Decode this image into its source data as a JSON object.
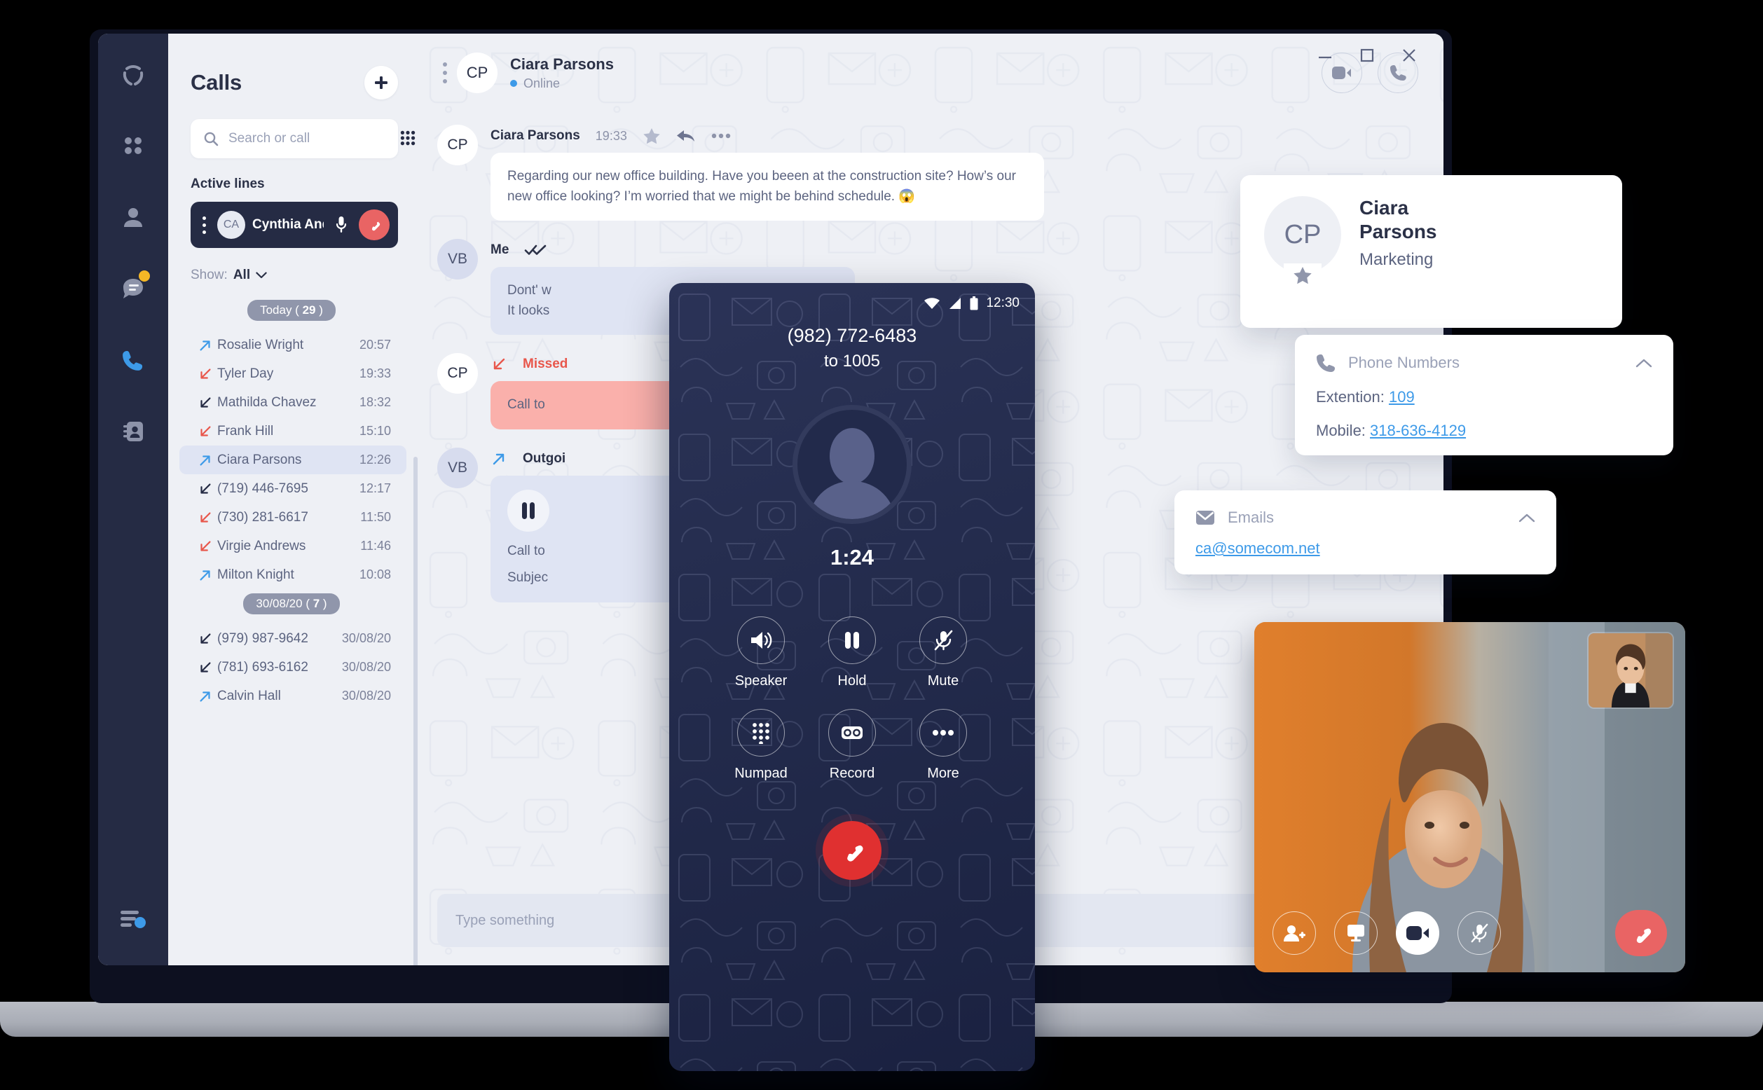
{
  "app": {
    "window_controls": {
      "minimize": "minimize-icon",
      "maximize": "maximize-icon",
      "close": "close-icon"
    }
  },
  "rail": {
    "logo": "app-logo",
    "items": [
      {
        "icon": "grid-apps-icon",
        "badge": ""
      },
      {
        "icon": "user-presence-icon",
        "badge": ""
      },
      {
        "icon": "chat-bubble-icon",
        "badge": "unread"
      },
      {
        "icon": "phone-icon",
        "badge": "",
        "active": true
      },
      {
        "icon": "contacts-book-icon",
        "badge": ""
      }
    ],
    "bottom_item": {
      "icon": "activity-list-icon"
    }
  },
  "calls_panel": {
    "title": "Calls",
    "add_button": "+",
    "search": {
      "placeholder": "Search or call",
      "value": "",
      "keypad_icon": "dialpad-icon"
    },
    "active_lines_label": "Active lines",
    "active_line": {
      "initials": "CA",
      "name": "Cynthia Ande...",
      "mic_icon": "microphone-icon",
      "end_icon": "hangup-icon"
    },
    "show_label": "Show:",
    "show_value": "All",
    "groups": [
      {
        "label": "Today",
        "count": "29",
        "rows": [
          {
            "direction": "outgoing",
            "name": "Rosalie Wright",
            "time": "20:57",
            "selected": false
          },
          {
            "direction": "missed",
            "name": "Tyler Day",
            "time": "19:33",
            "selected": false
          },
          {
            "direction": "incoming",
            "name": "Mathilda Chavez",
            "time": "18:32",
            "selected": false
          },
          {
            "direction": "missed",
            "name": "Frank Hill",
            "time": "15:10",
            "selected": false
          },
          {
            "direction": "outgoing",
            "name": "Ciara Parsons",
            "time": "12:26",
            "selected": true
          },
          {
            "direction": "incoming",
            "name": "(719) 446-7695",
            "time": "12:17",
            "selected": false
          },
          {
            "direction": "missed",
            "name": "(730) 281-6617",
            "time": "11:50",
            "selected": false
          },
          {
            "direction": "missed",
            "name": "Virgie Andrews",
            "time": "11:46",
            "selected": false
          },
          {
            "direction": "outgoing",
            "name": "Milton Knight",
            "time": "10:08",
            "selected": false
          }
        ]
      },
      {
        "label": "30/08/20",
        "count": "7",
        "rows": [
          {
            "direction": "incoming",
            "name": "(979) 987-9642",
            "time": "30/08/20",
            "selected": false
          },
          {
            "direction": "incoming",
            "name": "(781) 693-6162",
            "time": "30/08/20",
            "selected": false
          },
          {
            "direction": "outgoing",
            "name": "Calvin Hall",
            "time": "30/08/20",
            "selected": false
          }
        ]
      }
    ]
  },
  "chat": {
    "header": {
      "initials": "CP",
      "name": "Ciara Parsons",
      "status": "Online",
      "video_call_icon": "video-camera-icon",
      "audio_call_icon": "phone-handset-icon",
      "menu_icon": "kebab-menu-icon"
    },
    "info_button": "info-icon",
    "messages": [
      {
        "initials": "CP",
        "avatar_style": "white",
        "from": "Ciara Parsons",
        "time": "19:33",
        "actions": [
          "star-icon",
          "reply-icon",
          "more-icon"
        ],
        "text": "Regarding our new office building. Have you beeen at the construction site? How’s our new office looking? I’m worried that we might be behind schedule. 😱",
        "kind": "incoming"
      },
      {
        "initials": "VB",
        "avatar_style": "blue",
        "from": "Me",
        "time": "",
        "read_icon": "double-check-icon",
        "text": "Dont' w\nIt looks",
        "kind": "me"
      },
      {
        "initials": "CP",
        "avatar_style": "white",
        "from": "Missed",
        "time": "",
        "text": "Call to",
        "kind": "missed"
      },
      {
        "initials": "VB",
        "avatar_style": "blue",
        "from": "Outgoi",
        "time": "",
        "text": "Call to",
        "text2": "Subjec",
        "kind": "outgoing-hold"
      }
    ],
    "composer": {
      "placeholder": "Type something",
      "value": "",
      "actions": [
        "emoji-icon",
        "microphone-icon",
        "attachment-icon"
      ]
    }
  },
  "contact_card": {
    "initials": "CP",
    "first_name": "Ciara",
    "last_name": "Parsons",
    "role": "Marketing",
    "favorite_icon": "star-icon"
  },
  "phone_numbers_card": {
    "icon": "phone-icon",
    "title": "Phone Numbers",
    "collapse_icon": "chevron-up-icon",
    "extension_label": "Extention:",
    "extension_value": "109",
    "mobile_label": "Mobile:",
    "mobile_value": "318-636-4129"
  },
  "emails_card": {
    "icon": "envelope-icon",
    "title": "Emails",
    "collapse_icon": "chevron-up-icon",
    "email": "ca@somecom.net"
  },
  "phone_overlay": {
    "status_bar": {
      "wifi": "wifi-icon",
      "signal": "signal-icon",
      "battery": "battery-icon",
      "time": "12:30"
    },
    "number": "(982) 772-6483",
    "to": "to 1005",
    "timer": "1:24",
    "buttons": [
      {
        "label": "Speaker",
        "icon": "speaker-icon"
      },
      {
        "label": "Hold",
        "icon": "pause-icon"
      },
      {
        "label": "Mute",
        "icon": "mic-muted-icon"
      },
      {
        "label": "Numpad",
        "icon": "dialpad-icon"
      },
      {
        "label": "Record",
        "icon": "voicemail-icon"
      },
      {
        "label": "More",
        "icon": "ellipsis-icon"
      }
    ],
    "end_call_icon": "hangup-icon"
  },
  "video_widget": {
    "controls": [
      {
        "icon": "add-participant-icon",
        "active": false
      },
      {
        "icon": "screen-share-icon",
        "active": false
      },
      {
        "icon": "video-camera-icon",
        "active": true
      },
      {
        "icon": "mic-muted-icon",
        "active": false
      }
    ],
    "end_call_icon": "hangup-icon"
  },
  "colors": {
    "navy": "#252b44",
    "panel_bg": "#eef0f5",
    "accent_blue": "#3d9ae8",
    "danger_red": "#e8574c",
    "end_red": "#e96464",
    "selected_row": "#dfe4f3",
    "badge_yellow": "#f5b726"
  }
}
